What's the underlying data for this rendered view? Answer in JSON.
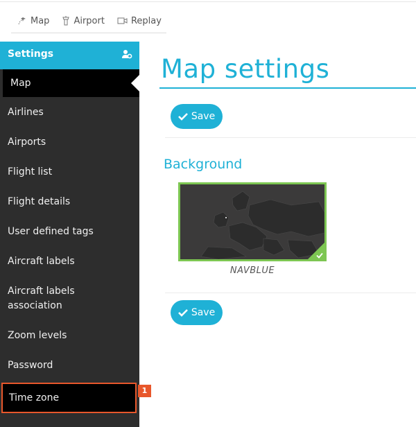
{
  "toolbar": {
    "tabs": [
      {
        "label": "Map",
        "icon": "plane-route-icon"
      },
      {
        "label": "Airport",
        "icon": "airport-tower-icon"
      },
      {
        "label": "Replay",
        "icon": "video-camera-icon"
      }
    ]
  },
  "sidebar": {
    "title": "Settings",
    "header_icon": "user-settings-icon",
    "items": [
      {
        "label": "Map",
        "active": true
      },
      {
        "label": "Airlines"
      },
      {
        "label": "Airports"
      },
      {
        "label": "Flight list"
      },
      {
        "label": "Flight details"
      },
      {
        "label": "User defined tags"
      },
      {
        "label": "Aircraft labels"
      },
      {
        "label": "Aircraft labels association"
      },
      {
        "label": "Zoom levels"
      },
      {
        "label": "Password"
      },
      {
        "label": "Time zone",
        "highlighted": true
      }
    ],
    "badge": "1"
  },
  "main": {
    "title": "Map settings",
    "save_label": "Save",
    "section_title": "Background",
    "background": {
      "label": "NAVBLUE",
      "selected": true
    }
  },
  "colors": {
    "accent": "#1fb1d6",
    "sidebar_bg": "#2d2d2d",
    "active_bg": "#000000",
    "highlight": "#e8572b",
    "selected": "#7dc652"
  }
}
